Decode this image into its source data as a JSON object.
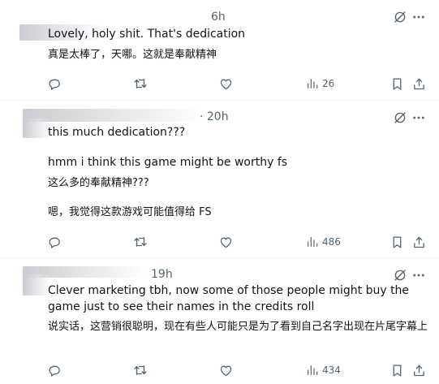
{
  "tweets": [
    {
      "time": "6h",
      "lines": [
        "Lovely, holy shit. That's dedication",
        "真是太棒了，天哪。这就是奉献精神"
      ],
      "views": "26"
    },
    {
      "time": "· 20h",
      "lines": [
        "this much dedication???",
        "hmm i think this game might be worthy fs",
        "这么多的奉献精神???",
        "嗯，我觉得这款游戏可能值得给 FS"
      ],
      "views": "486"
    },
    {
      "time": "19h",
      "lines": [
        "Clever marketing tbh, now some of those people might buy the game just to see their names in the credits roll",
        "说实话，这营销很聪明，现在有些人可能只是为了看到自己名字出现在片尾字幕上"
      ],
      "views": "434"
    }
  ],
  "icons": {
    "grok": "grok-icon",
    "more": "more-icon",
    "reply": "reply-icon",
    "retweet": "retweet-icon",
    "like": "like-icon",
    "views": "views-icon",
    "bookmark": "bookmark-icon",
    "share": "share-icon"
  },
  "colors": {
    "text": "#0f1419",
    "secondary": "#536471",
    "divider": "#eff3f4"
  }
}
